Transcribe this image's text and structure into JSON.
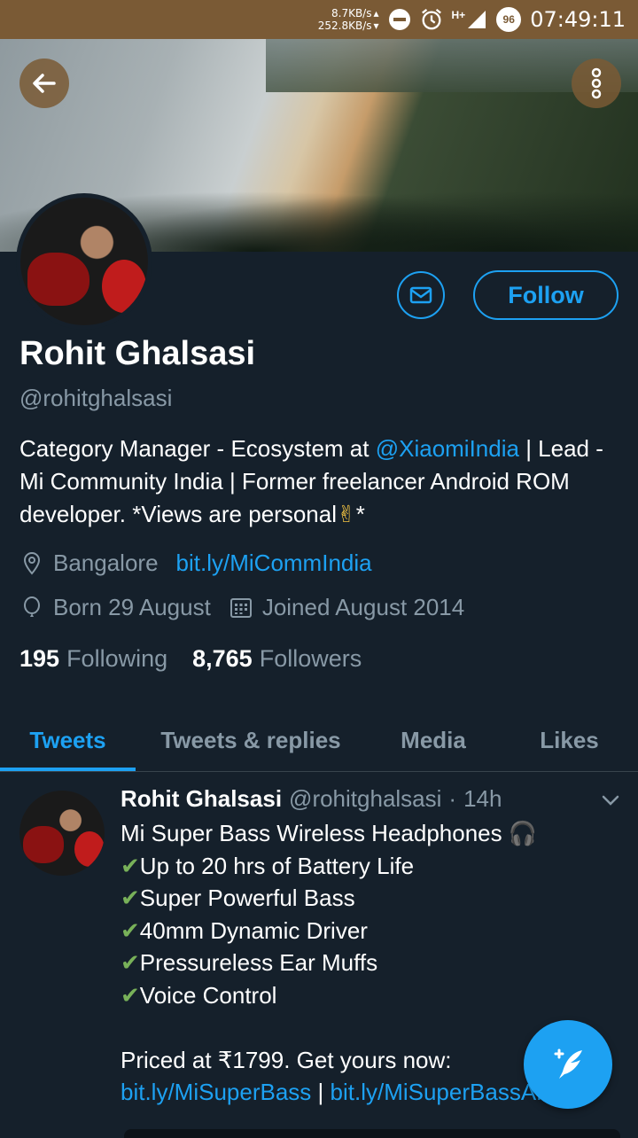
{
  "status_bar": {
    "speed_up": "8.7KB/s",
    "speed_down": "252.8KB/s",
    "network": "H+",
    "battery": "96",
    "time": "07:49:11"
  },
  "profile": {
    "name": "Rohit Ghalsasi",
    "handle": "@rohitghalsasi",
    "follow_label": "Follow",
    "bio": {
      "part1": "Category Manager - Ecosystem at ",
      "mention": "@XiaomiIndia",
      "part2": " | Lead - Mi Community India | Former freelancer Android ROM developer. *Views are personal",
      "emoji": "✌",
      "part3": "*"
    },
    "location": "Bangalore",
    "website": "bit.ly/MiCommIndia",
    "birthday": "Born 29 August",
    "joined": "Joined August 2014",
    "following_count": "195",
    "following_label": "Following",
    "followers_count": "8,765",
    "followers_label": "Followers"
  },
  "tabs": [
    {
      "label": "Tweets",
      "active": true
    },
    {
      "label": "Tweets & replies",
      "active": false
    },
    {
      "label": "Media",
      "active": false
    },
    {
      "label": "Likes",
      "active": false
    }
  ],
  "tweet": {
    "name": "Rohit Ghalsasi",
    "handle": "@rohitghalsasi",
    "dot": "·",
    "time": "14h",
    "title": "Mi Super Bass Wireless Headphones ",
    "headphone_emoji": "🎧",
    "check": "✔",
    "features": [
      "Up to 20 hrs of Battery Life",
      "Super Powerful Bass",
      "40mm Dynamic Driver",
      "Pressureless Ear Muffs",
      "Voice Control"
    ],
    "price_text": "Priced at ₹1799. Get yours now: ",
    "link1": "bit.ly/MiSuperBass",
    "separator": " | ",
    "link2": "bit.ly/MiSuperBassAMZ"
  },
  "colors": {
    "background": "#15202b",
    "accent": "#1da1f2",
    "muted": "#8899a6",
    "status_bar": "#7a5a35"
  },
  "icons": [
    "back-arrow-icon",
    "more-vertical-icon",
    "mail-icon",
    "location-pin-icon",
    "balloon-icon",
    "calendar-icon",
    "chevron-down-icon",
    "compose-tweet-icon"
  ]
}
